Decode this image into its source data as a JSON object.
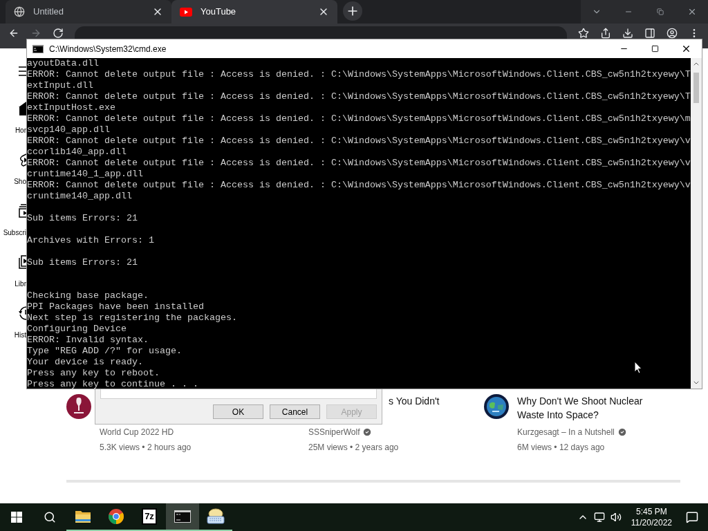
{
  "browser": {
    "tabs": [
      {
        "title": "Untitled",
        "kind": "globe",
        "selected": false
      },
      {
        "title": "YouTube",
        "kind": "youtube",
        "selected": true
      }
    ]
  },
  "sidebar": {
    "items": [
      {
        "label": "Hor",
        "kind": "home"
      },
      {
        "label": "Sho",
        "kind": "shorts"
      },
      {
        "label": "Subscri",
        "kind": "subscriptions"
      },
      {
        "label": "Libr",
        "kind": "library"
      },
      {
        "label": "Hist",
        "kind": "history"
      }
    ]
  },
  "videos": [
    {
      "kind": "trophy",
      "channel": "World Cup 2022 HD",
      "verified": false,
      "meta": "5.3K views • 2 hours ago"
    },
    {
      "title_lines": [
        "s You Didn't"
      ],
      "title_covered": true,
      "channel": "SSSniperWolf",
      "verified": true,
      "meta": "25M views • 2 years ago"
    },
    {
      "kind": "globe",
      "title_lines": [
        "Why Don't We Shoot Nuclear",
        "Waste Into Space?"
      ],
      "title_covered": false,
      "channel": "Kurzgesagt – In a Nutshell",
      "verified": true,
      "meta": "6M views • 12 days ago"
    }
  ],
  "dialog": {
    "buttons": [
      {
        "label": "OK",
        "disabled": false
      },
      {
        "label": "Cancel",
        "disabled": false
      },
      {
        "label": "Apply",
        "disabled": true
      }
    ]
  },
  "console": {
    "title": "C:\\Windows\\System32\\cmd.exe",
    "blocks": [
      {
        "lines": [
          "ayoutData.dll",
          "ERROR: Cannot delete output file : Access is denied. : C:\\Windows\\SystemApps\\MicrosoftWindows.Client.CBS_cw5n1h2txyewy\\T",
          "extInput.dll",
          "ERROR: Cannot delete output file : Access is denied. : C:\\Windows\\SystemApps\\MicrosoftWindows.Client.CBS_cw5n1h2txyewy\\T",
          "extInputHost.exe",
          "ERROR: Cannot delete output file : Access is denied. : C:\\Windows\\SystemApps\\MicrosoftWindows.Client.CBS_cw5n1h2txyewy\\m",
          "svcp140_app.dll",
          "ERROR: Cannot delete output file : Access is denied. : C:\\Windows\\SystemApps\\MicrosoftWindows.Client.CBS_cw5n1h2txyewy\\v",
          "ccorlib140_app.dll",
          "ERROR: Cannot delete output file : Access is denied. : C:\\Windows\\SystemApps\\MicrosoftWindows.Client.CBS_cw5n1h2txyewy\\v",
          "cruntime140_1_app.dll",
          "ERROR: Cannot delete output file : Access is denied. : C:\\Windows\\SystemApps\\MicrosoftWindows.Client.CBS_cw5n1h2txyewy\\v",
          "cruntime140_app.dll"
        ]
      },
      {
        "lines": [
          "Sub items Errors: 21"
        ]
      },
      {
        "lines": [
          "Archives with Errors: 1"
        ]
      },
      {
        "lines": [
          "Sub items Errors: 21"
        ]
      },
      {
        "lines": [
          "Checking base package.",
          "PPI Packages have been installed",
          "Next step is registering the packages.",
          "Configuring Device",
          "ERROR: Invalid syntax.",
          "Type \"REG ADD /?\" for usage.",
          "Your device is ready.",
          "Press any key to reboot.",
          "Press any key to continue . . ."
        ]
      }
    ]
  },
  "taskbar": {
    "apps": [
      {
        "kind": "explorer",
        "running": true,
        "selected": false
      },
      {
        "kind": "chrome",
        "running": true,
        "selected": false
      },
      {
        "kind": "sevenzip",
        "label": "7z",
        "running": true,
        "selected": false
      },
      {
        "kind": "terminal",
        "running": true,
        "selected": true
      },
      {
        "kind": "keyboard",
        "running": true,
        "selected": false
      }
    ],
    "time": "5:45 PM",
    "date": "11/20/2022"
  }
}
